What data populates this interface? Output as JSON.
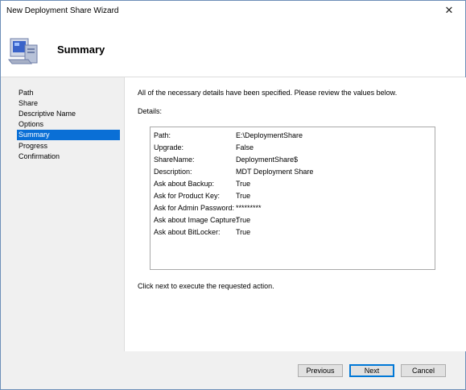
{
  "window": {
    "title": "New Deployment Share Wizard",
    "close_glyph": "✕"
  },
  "header": {
    "title": "Summary",
    "icon": "computer-icon"
  },
  "steps": [
    {
      "label": "Path",
      "active": false
    },
    {
      "label": "Share",
      "active": false
    },
    {
      "label": "Descriptive Name",
      "active": false
    },
    {
      "label": "Options",
      "active": false
    },
    {
      "label": "Summary",
      "active": true
    },
    {
      "label": "Progress",
      "active": false
    },
    {
      "label": "Confirmation",
      "active": false
    }
  ],
  "content": {
    "intro": "All of the necessary details have been specified.  Please review the values below.",
    "details_label": "Details:",
    "details": [
      {
        "key": "Path:",
        "value": "E:\\DeploymentShare"
      },
      {
        "key": "Upgrade:",
        "value": "False"
      },
      {
        "key": "ShareName:",
        "value": "DeploymentShare$"
      },
      {
        "key": "Description:",
        "value": "MDT Deployment Share"
      },
      {
        "key": "Ask about Backup:",
        "value": "True"
      },
      {
        "key": "Ask for Product Key:",
        "value": "True"
      },
      {
        "key": "Ask for Admin Password:",
        "value": "*********"
      },
      {
        "key": "Ask about Image Capture:",
        "value": "True"
      },
      {
        "key": "Ask about BitLocker:",
        "value": "True"
      }
    ],
    "footnote": "Click next to execute the requested action."
  },
  "buttons": {
    "previous": "Previous",
    "next": "Next",
    "cancel": "Cancel"
  },
  "colors": {
    "selection": "#0a6fd6",
    "default_button_border": "#0078d7"
  }
}
